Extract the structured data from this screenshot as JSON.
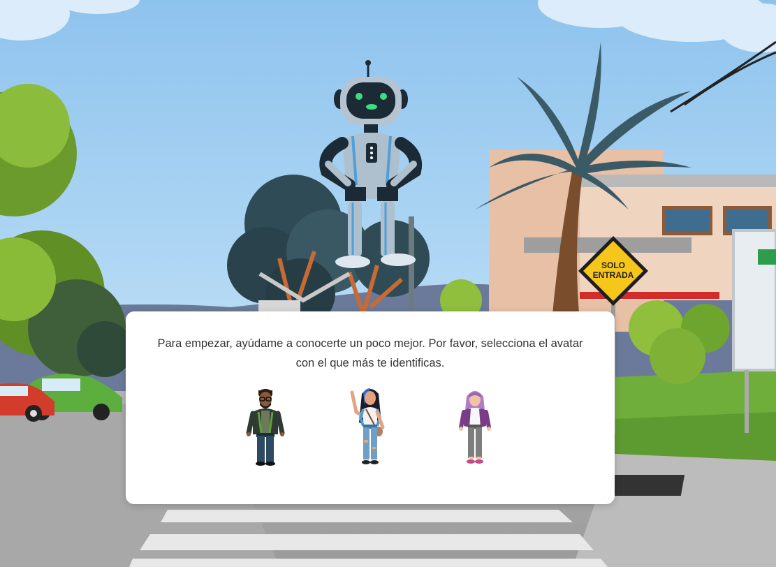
{
  "scene": {
    "sign_line1": "SOLO",
    "sign_line2": "ENTRADA"
  },
  "dialog": {
    "line1": "Para empezar, ayúdame a conocerte un poco mejor. Por favor, selecciona el avatar",
    "line2": "con el que más te identificas."
  },
  "colors": {
    "sky": "#9cc9ef",
    "dialog_bg": "#ffffff",
    "text": "#333333",
    "sign_yellow": "#f6c71a",
    "robot_eyes": "#3ddc84"
  },
  "icons": [
    "robot-icon",
    "avatar-man-icon",
    "avatar-woman-waving-icon",
    "avatar-woman-purple-hair-icon"
  ]
}
